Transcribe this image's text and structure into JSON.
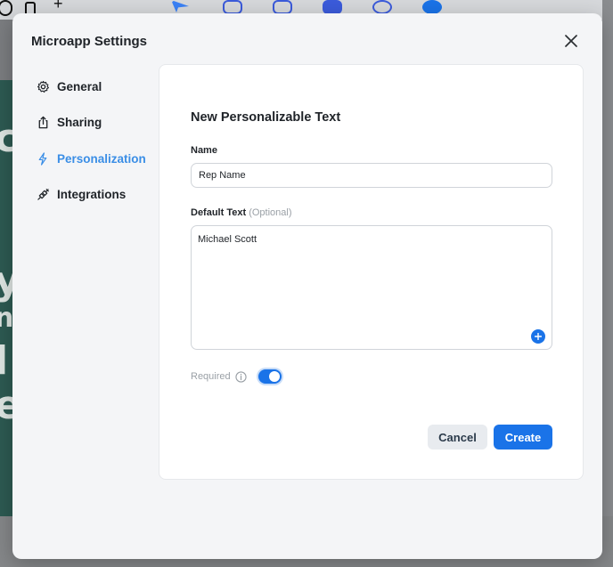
{
  "modal": {
    "title": "Microapp Settings",
    "close_icon": "close-icon"
  },
  "nav": {
    "items": [
      {
        "label": "General",
        "icon": "gear-icon"
      },
      {
        "label": "Sharing",
        "icon": "share-icon"
      },
      {
        "label": "Personalization",
        "icon": "lightning-icon",
        "active": true
      },
      {
        "label": "Integrations",
        "icon": "plug-icon"
      }
    ]
  },
  "panel": {
    "title": "New Personalizable Text",
    "name_label": "Name",
    "name_value": "Rep Name",
    "default_text_label": "Default Text",
    "default_text_optional": "(Optional)",
    "default_text_value": "Michael Scott",
    "required_label": "Required",
    "required_on": true,
    "cancel_label": "Cancel",
    "create_label": "Create"
  },
  "colors": {
    "accent": "#1a73e8",
    "active_nav": "#3a8ee6"
  }
}
